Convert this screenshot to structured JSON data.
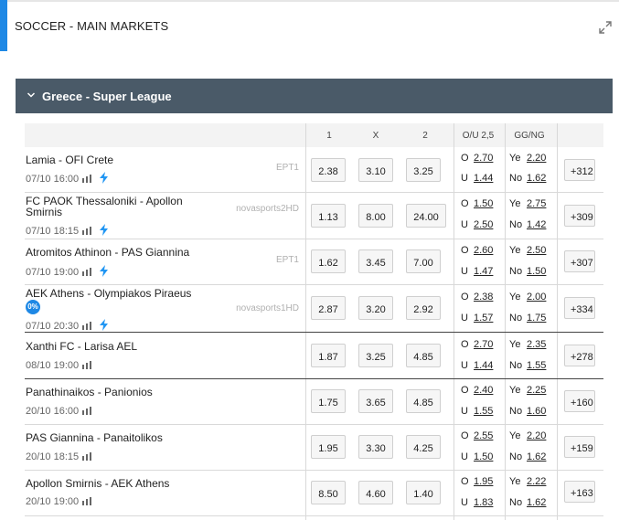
{
  "section": {
    "title": "SOCCER - MAIN MARKETS"
  },
  "league": {
    "name": "Greece - Super League"
  },
  "headers": {
    "h1": "1",
    "hx": "X",
    "h2": "2",
    "ou": "O/U 2,5",
    "ggng": "GG/NG"
  },
  "labels": {
    "over": "O",
    "under": "U",
    "yes": "Ye",
    "no": "No"
  },
  "colors": {
    "accent": "#1e88e5",
    "league_bar": "#4a5a68"
  },
  "matches": [
    {
      "teams": "Lamia - OFI Crete",
      "datetime": "07/10 16:00",
      "channel": "EPT1",
      "live": true,
      "odds": [
        "2.38",
        "3.10",
        "3.25"
      ],
      "over": "2.70",
      "under": "1.44",
      "yes": "2.20",
      "no": "1.62",
      "more": "+312"
    },
    {
      "teams": "FC PAOK Thessaloniki - Apollon Smirnis",
      "datetime": "07/10 18:15",
      "channel": "novasports2HD",
      "live": true,
      "odds": [
        "1.13",
        "8.00",
        "24.00"
      ],
      "over": "1.50",
      "under": "2.50",
      "yes": "2.75",
      "no": "1.42",
      "more": "+309"
    },
    {
      "teams": "Atromitos Athinon - PAS Giannina",
      "datetime": "07/10 19:00",
      "channel": "EPT1",
      "live": true,
      "odds": [
        "1.62",
        "3.45",
        "7.00"
      ],
      "over": "2.60",
      "under": "1.47",
      "yes": "2.50",
      "no": "1.50",
      "more": "+307"
    },
    {
      "teams": "AEK Athens - Olympiakos Piraeus",
      "badge": "0%",
      "datetime": "07/10 20:30",
      "channel": "novasports1HD",
      "live": true,
      "odds": [
        "2.87",
        "3.20",
        "2.92"
      ],
      "over": "2.38",
      "under": "1.57",
      "yes": "2.00",
      "no": "1.75",
      "more": "+334"
    },
    {
      "teams": "Xanthi FC - Larisa AEL",
      "datetime": "08/10 19:00",
      "channel": "",
      "live": false,
      "odds": [
        "1.87",
        "3.25",
        "4.85"
      ],
      "over": "2.70",
      "under": "1.44",
      "yes": "2.35",
      "no": "1.55",
      "more": "+278"
    },
    {
      "teams": "Panathinaikos - Panionios",
      "datetime": "20/10 16:00",
      "channel": "",
      "live": false,
      "odds": [
        "1.75",
        "3.65",
        "4.85"
      ],
      "over": "2.40",
      "under": "1.55",
      "yes": "2.25",
      "no": "1.60",
      "more": "+160"
    },
    {
      "teams": "PAS Giannina - Panaitolikos",
      "datetime": "20/10 18:15",
      "channel": "",
      "live": false,
      "odds": [
        "1.95",
        "3.30",
        "4.25"
      ],
      "over": "2.55",
      "under": "1.50",
      "yes": "2.20",
      "no": "1.62",
      "more": "+159"
    },
    {
      "teams": "Apollon Smirnis - AEK Athens",
      "datetime": "20/10 19:00",
      "channel": "",
      "live": false,
      "odds": [
        "8.50",
        "4.60",
        "1.40"
      ],
      "over": "1.95",
      "under": "1.83",
      "yes": "2.22",
      "no": "1.62",
      "more": "+163"
    }
  ]
}
